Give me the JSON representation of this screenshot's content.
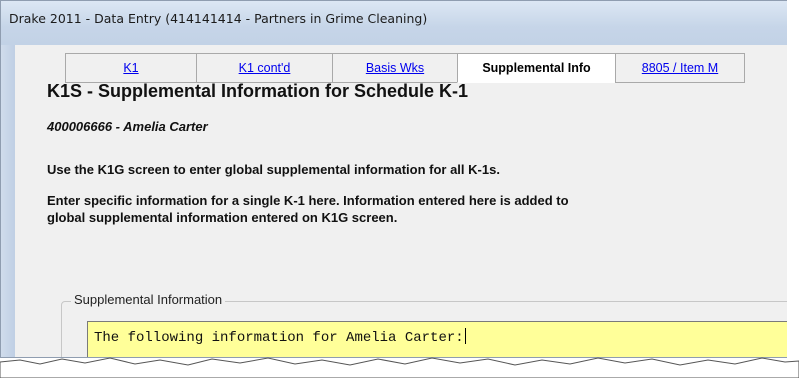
{
  "window": {
    "title": "Drake 2011 - Data Entry (414141414 - Partners in Grime Cleaning)"
  },
  "tabs": [
    {
      "label": "K1",
      "active": false
    },
    {
      "label": "K1 cont'd",
      "active": false
    },
    {
      "label": "Basis Wks",
      "active": false
    },
    {
      "label": "Supplemental Info",
      "active": true
    },
    {
      "label": "8805 / Item M",
      "active": false
    }
  ],
  "page": {
    "heading": "K1S - Supplemental Information for Schedule K-1",
    "recipient": "400006666 - Amelia Carter",
    "instruction_1": "Use the K1G screen to enter global supplemental information for all K-1s.",
    "instruction_2_line1": "Enter specific information for a single K-1 here. Information entered here is added to",
    "instruction_2_line2": "global supplemental information entered on K1G screen."
  },
  "supplemental": {
    "legend": "Supplemental Information",
    "text": "The following information for Amelia Carter:"
  },
  "colors": {
    "text_area_bg": "#ffff99",
    "link": "#0000ee",
    "titlebar": "#c6d5e8"
  }
}
